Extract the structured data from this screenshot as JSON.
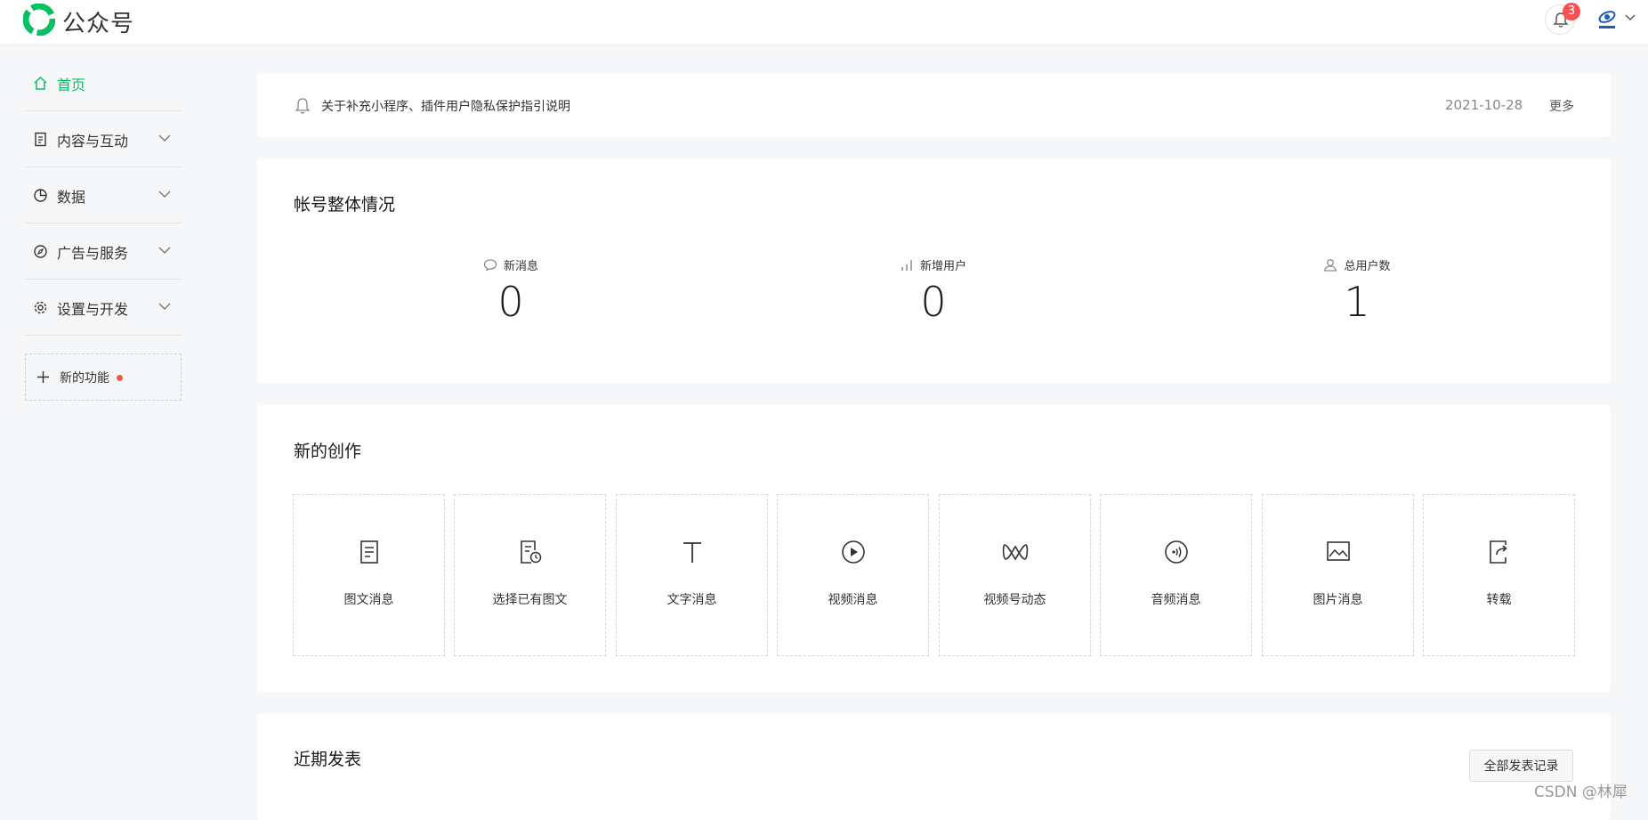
{
  "header": {
    "brand": "公众号",
    "notification_count": "3",
    "colors": {
      "accent": "#07c160",
      "badge": "#fa5151"
    }
  },
  "sidebar": {
    "items": [
      {
        "label": "首页",
        "icon": "home-icon",
        "active": true
      },
      {
        "label": "内容与互动",
        "icon": "document-icon"
      },
      {
        "label": "数据",
        "icon": "pie-chart-icon"
      },
      {
        "label": "广告与服务",
        "icon": "compass-icon"
      },
      {
        "label": "设置与开发",
        "icon": "gear-icon"
      }
    ],
    "new_feature": "新的功能"
  },
  "notice": {
    "text": "关于补充小程序、插件用户隐私保护指引说明",
    "date": "2021-10-28",
    "more": "更多"
  },
  "overview": {
    "title": "帐号整体情况",
    "stats": [
      {
        "label": "新消息",
        "value": "0",
        "icon": "chat-bubble-icon"
      },
      {
        "label": "新增用户",
        "value": "0",
        "icon": "bar-chart-icon"
      },
      {
        "label": "总用户数",
        "value": "1",
        "icon": "user-icon"
      }
    ]
  },
  "create": {
    "title": "新的创作",
    "tiles": [
      {
        "label": "图文消息",
        "icon": "article-icon"
      },
      {
        "label": "选择已有图文",
        "icon": "article-clock-icon"
      },
      {
        "label": "文字消息",
        "icon": "text-icon"
      },
      {
        "label": "视频消息",
        "icon": "play-icon"
      },
      {
        "label": "视频号动态",
        "icon": "channels-icon"
      },
      {
        "label": "音频消息",
        "icon": "audio-icon"
      },
      {
        "label": "图片消息",
        "icon": "image-icon"
      },
      {
        "label": "转载",
        "icon": "share-icon"
      }
    ]
  },
  "recent": {
    "title": "近期发表",
    "all_button": "全部发表记录"
  },
  "watermark": "CSDN @林犀"
}
